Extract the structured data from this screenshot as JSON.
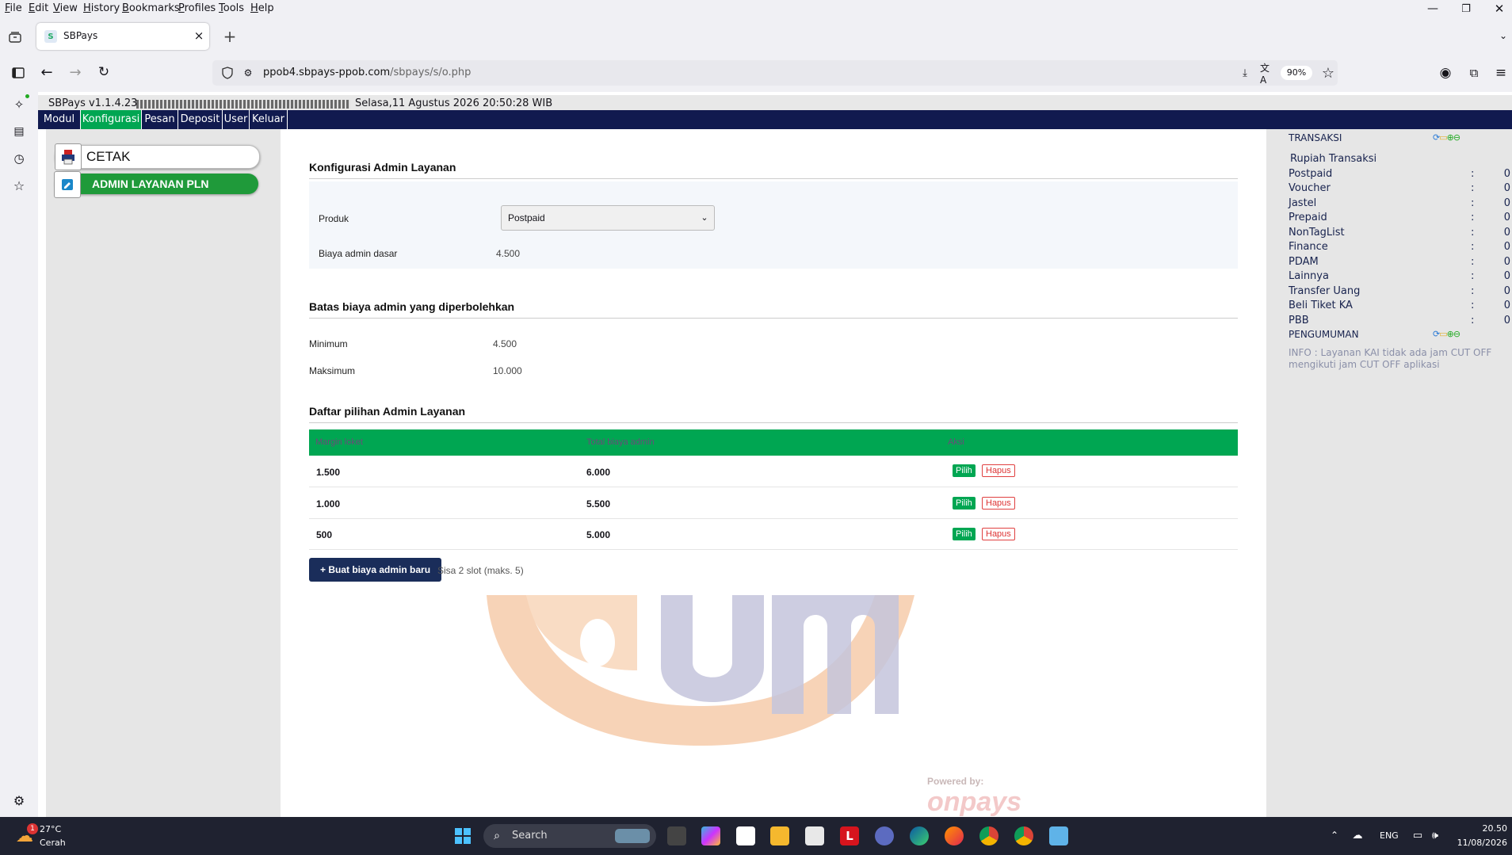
{
  "menubar": {
    "items": [
      "File",
      "Edit",
      "View",
      "History",
      "Bookmarks",
      "Profiles",
      "Tools",
      "Help"
    ]
  },
  "tab": {
    "title": "SBPays",
    "close": "×",
    "new_tab": "+"
  },
  "navbar": {
    "url_domain": "ppob4.sbpays-ppob.com",
    "url_path": "/sbpays/s/o.php",
    "zoom": "90%"
  },
  "app": {
    "header_version": "SBPays v1.1.4.23",
    "header_date": "Selasa,11 Agustus 2026 20:50:28 WIB",
    "nav": [
      "Modul",
      "Konfigurasi",
      "Pesan",
      "Deposit",
      "User",
      "Keluar"
    ],
    "nav_active": "Konfigurasi"
  },
  "left_menu": {
    "cetak": "CETAK",
    "admin_pln": "ADMIN LAYANAN PLN"
  },
  "config": {
    "title": "Konfigurasi Admin Layanan",
    "produk_label": "Produk",
    "produk_value": "Postpaid",
    "biaya_label": "Biaya admin dasar",
    "biaya_value": "4.500",
    "batas_title": "Batas biaya admin yang diperbolehkan",
    "min_label": "Minimum",
    "min_value": "4.500",
    "max_label": "Maksimum",
    "max_value": "10.000",
    "daftar_title": "Daftar pilihan Admin Layanan",
    "table_headers": [
      "Margin loket",
      "Total biaya admin",
      "Aksi"
    ],
    "rows": [
      {
        "margin": "1.500",
        "total": "6.000"
      },
      {
        "margin": "1.000",
        "total": "5.500"
      },
      {
        "margin": "500",
        "total": "5.000"
      }
    ],
    "pilih_label": "Pilih",
    "hapus_label": "Hapus",
    "new_button": "+ Buat biaya admin baru",
    "slot_text": "Sisa 2 slot (maks. 5)",
    "powered_by": "Powered by:",
    "powered_logo_text": "onpays"
  },
  "transaksi": {
    "title": "TRANSAKSI",
    "subtitle": "Rupiah Transaksi",
    "items": [
      {
        "name": "Postpaid",
        "value": "0"
      },
      {
        "name": "Voucher",
        "value": "0"
      },
      {
        "name": "Jastel",
        "value": "0"
      },
      {
        "name": "Prepaid",
        "value": "0"
      },
      {
        "name": "NonTagList",
        "value": "0"
      },
      {
        "name": "Finance",
        "value": "0"
      },
      {
        "name": "PDAM",
        "value": "0"
      },
      {
        "name": "Lainnya",
        "value": "0"
      },
      {
        "name": "Transfer Uang",
        "value": "0"
      },
      {
        "name": "Beli Tiket KA",
        "value": "0"
      },
      {
        "name": "PBB",
        "value": "0"
      }
    ],
    "sep": ":",
    "pengumuman_title": "PENGUMUMAN",
    "info": "INFO : Layanan KAI tidak ada jam CUT OFF mengikuti jam CUT OFF aplikasi"
  },
  "taskbar": {
    "temp": "27°C",
    "weather": "Cerah",
    "weather_badge": "1",
    "search": "Search",
    "lang": "ENG",
    "time": "20.50",
    "date": "11/08/2026"
  },
  "colors": {
    "navy": "#111a4f",
    "green": "#00a652",
    "button_dark": "#1a2d5a"
  }
}
